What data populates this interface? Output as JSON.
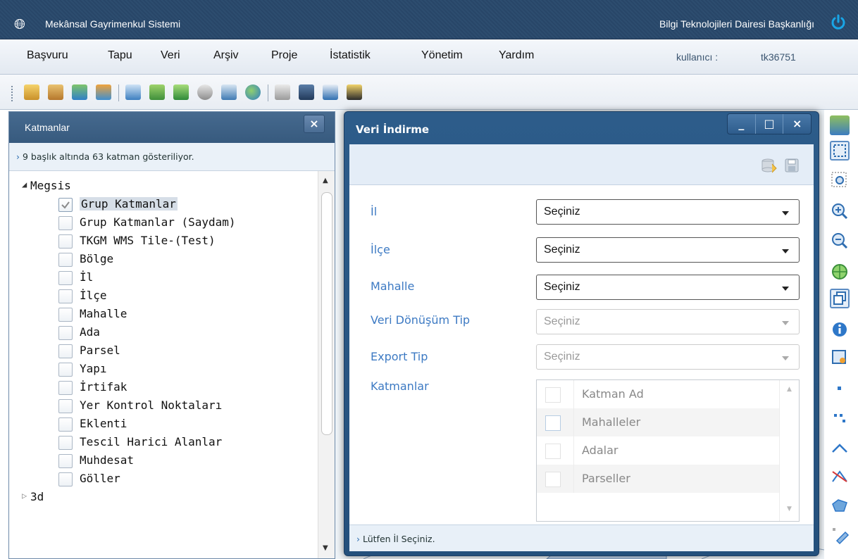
{
  "titlebar": {
    "app_title": "Mekânsal Gayrimenkul Sistemi",
    "org_name": "Bilgi Teknolojileri Dairesi Başkanlığı"
  },
  "menubar": {
    "items": [
      "Başvuru",
      "Tapu",
      "Veri",
      "Arşiv",
      "Proje",
      "İstatistik",
      "Yönetim",
      "Yardım"
    ],
    "user_label": "kullanıcı :",
    "user_name": "tk36751"
  },
  "layers_panel": {
    "title": "Katmanlar",
    "close_label": "×",
    "info": "9 başlık altında 63 katman gösteriliyor.",
    "groups": [
      {
        "name": "Megsis",
        "expanded": true,
        "items": [
          {
            "label": "Grup Katmanlar",
            "checked": true
          },
          {
            "label": "Grup Katmanlar (Saydam)",
            "checked": false
          },
          {
            "label": "TKGM WMS Tile-(Test)",
            "checked": false
          },
          {
            "label": "Bölge",
            "checked": false
          },
          {
            "label": "İl",
            "checked": false
          },
          {
            "label": "İlçe",
            "checked": false
          },
          {
            "label": "Mahalle",
            "checked": false
          },
          {
            "label": "Ada",
            "checked": false
          },
          {
            "label": "Parsel",
            "checked": false
          },
          {
            "label": "Yapı",
            "checked": false
          },
          {
            "label": "İrtifak",
            "checked": false
          },
          {
            "label": "Yer Kontrol Noktaları",
            "checked": false
          },
          {
            "label": "Eklenti",
            "checked": false
          },
          {
            "label": "Tescil Harici Alanlar",
            "checked": false
          },
          {
            "label": "Muhdesat",
            "checked": false
          },
          {
            "label": "Göller",
            "checked": false
          }
        ]
      },
      {
        "name": "3d",
        "expanded": false,
        "items": []
      }
    ]
  },
  "dialog": {
    "title": "Veri İndirme",
    "buttons": {
      "minimize": "_",
      "maximize": "□",
      "close": "×"
    },
    "fields": [
      {
        "label": "İl",
        "value": "Seçiniz",
        "enabled": true
      },
      {
        "label": "İlçe",
        "value": "Seçiniz",
        "enabled": true
      },
      {
        "label": "Mahalle",
        "value": "Seçiniz",
        "enabled": true
      },
      {
        "label": "Veri Dönüşüm Tip",
        "value": "Seçiniz",
        "enabled": false
      },
      {
        "label": "Export Tip",
        "value": "Seçiniz",
        "enabled": false
      }
    ],
    "layers_label": "Katmanlar",
    "grid": {
      "header": "Katman Ad",
      "rows": [
        "Mahalleler",
        "Adalar",
        "Parseller"
      ]
    },
    "status": "Lütfen İl Seçiniz."
  },
  "colors": {
    "titlebar_bg": "#2d4d6f",
    "dialog_frame": "#2d5c8a",
    "label_blue": "#3d7ac3"
  }
}
